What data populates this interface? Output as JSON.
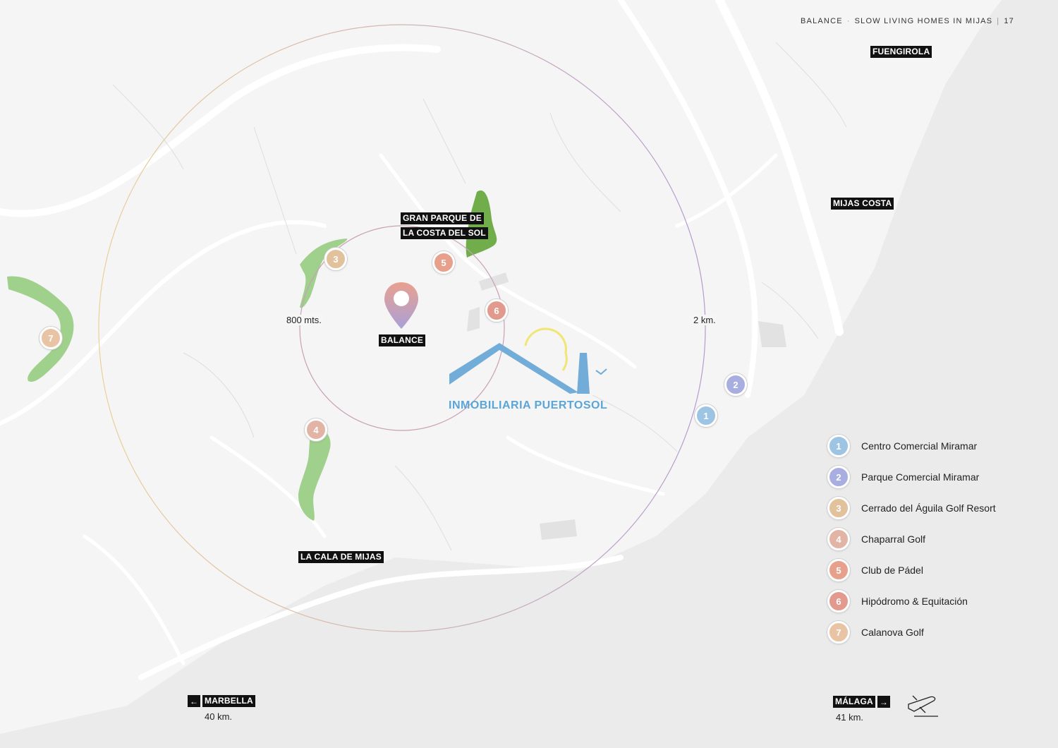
{
  "header": {
    "brand": "BALANCE",
    "subtitle": "SLOW LIVING HOMES IN MIJAS",
    "page_number": "17"
  },
  "places": {
    "fuengirola": "FUENGIROLA",
    "mijas_costa": "MIJAS COSTA",
    "gran_parque_line1": "GRAN PARQUE DE",
    "gran_parque_line2": "LA COSTA DEL SOL",
    "balance": "BALANCE",
    "la_cala": "LA CALA DE MIJAS"
  },
  "distances": {
    "inner": "800 mts.",
    "outer": "2 km."
  },
  "watermark": "INMOBILIARIA PUERTOSOL",
  "directions": {
    "left": {
      "arrow": "←",
      "name": "MARBELLA",
      "km": "40 km."
    },
    "right": {
      "arrow": "→",
      "name": "MÁLAGA",
      "km": "41 km."
    }
  },
  "icons": {
    "location_pin": "map-pin-icon",
    "airplane": "airplane-icon",
    "arrow_left": "arrow-left-icon",
    "arrow_right": "arrow-right-icon"
  },
  "markers": {
    "m1": "1",
    "m2": "2",
    "m3": "3",
    "m4": "4",
    "m5": "5",
    "m6": "6",
    "m7": "7"
  },
  "legend": [
    {
      "num": "1",
      "label": "Centro Comercial Miramar",
      "color": "#9ec4e4"
    },
    {
      "num": "2",
      "label": "Parque Comercial Miramar",
      "color": "#a9aee0"
    },
    {
      "num": "3",
      "label": "Cerrado del Águila Golf Resort",
      "color": "#e2c29c"
    },
    {
      "num": "4",
      "label": "Chaparral Golf",
      "color": "#e2b4a6"
    },
    {
      "num": "5",
      "label": "Club de Pádel",
      "color": "#e6a08c"
    },
    {
      "num": "6",
      "label": "Hipódromo & Equitación",
      "color": "#e39a8e"
    },
    {
      "num": "7",
      "label": "Calanova Golf",
      "color": "#e8c4a4"
    }
  ],
  "colors": {
    "green_area": "#9fd18c",
    "dark_green_area": "#72ad4c",
    "inner_ring": "#c9a0b6",
    "outer_ring_warm": "#eccf98",
    "outer_ring_cool": "#b59ad0",
    "pin": "#c69ab8",
    "watermark_blue": "#5aa5d8",
    "sea": "#ececec"
  }
}
